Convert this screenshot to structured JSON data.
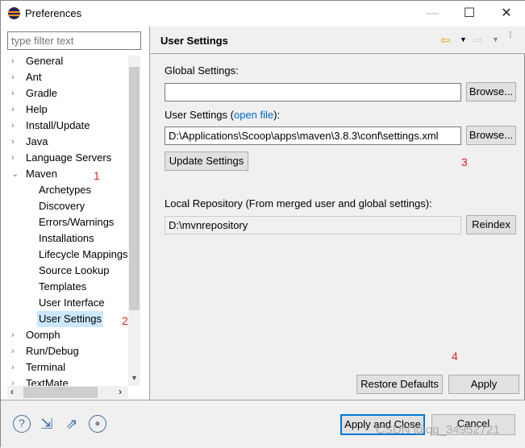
{
  "window": {
    "title": "Preferences",
    "minimize": "—",
    "maximize": "☐",
    "close": "✕"
  },
  "filter": {
    "placeholder": "type filter text"
  },
  "tree": [
    {
      "label": "General",
      "level": 0
    },
    {
      "label": "Ant",
      "level": 0
    },
    {
      "label": "Gradle",
      "level": 0
    },
    {
      "label": "Help",
      "level": 0
    },
    {
      "label": "Install/Update",
      "level": 0
    },
    {
      "label": "Java",
      "level": 0
    },
    {
      "label": "Language Servers",
      "level": 0
    },
    {
      "label": "Maven",
      "level": 0,
      "expanded": true
    },
    {
      "label": "Archetypes",
      "level": 1
    },
    {
      "label": "Discovery",
      "level": 1
    },
    {
      "label": "Errors/Warnings",
      "level": 1
    },
    {
      "label": "Installations",
      "level": 1
    },
    {
      "label": "Lifecycle Mappings",
      "level": 1
    },
    {
      "label": "Source Lookup",
      "level": 1
    },
    {
      "label": "Templates",
      "level": 1
    },
    {
      "label": "User Interface",
      "level": 1
    },
    {
      "label": "User Settings",
      "level": 1,
      "selected": true
    },
    {
      "label": "Oomph",
      "level": 0
    },
    {
      "label": "Run/Debug",
      "level": 0
    },
    {
      "label": "Terminal",
      "level": 0
    },
    {
      "label": "TextMate",
      "level": 0
    }
  ],
  "page": {
    "title": "User Settings",
    "global_label": "Global Settings:",
    "global_value": "",
    "browse": "Browse...",
    "user_label_pre": "User Settings (",
    "user_label_link": "open file",
    "user_label_post": "):",
    "user_value": "D:\\Applications\\Scoop\\apps\\maven\\3.8.3\\conf\\settings.xml",
    "update": "Update Settings",
    "local_label": "Local Repository (From merged user and global settings):",
    "local_value": "D:\\mvnrepository",
    "reindex": "Reindex",
    "restore": "Restore Defaults",
    "apply": "Apply"
  },
  "annotations": [
    "1",
    "2",
    "3",
    "4"
  ],
  "footer": {
    "apply_close": "Apply and Close",
    "cancel": "Cancel",
    "watermark": "CSDN @qq_34952721"
  }
}
